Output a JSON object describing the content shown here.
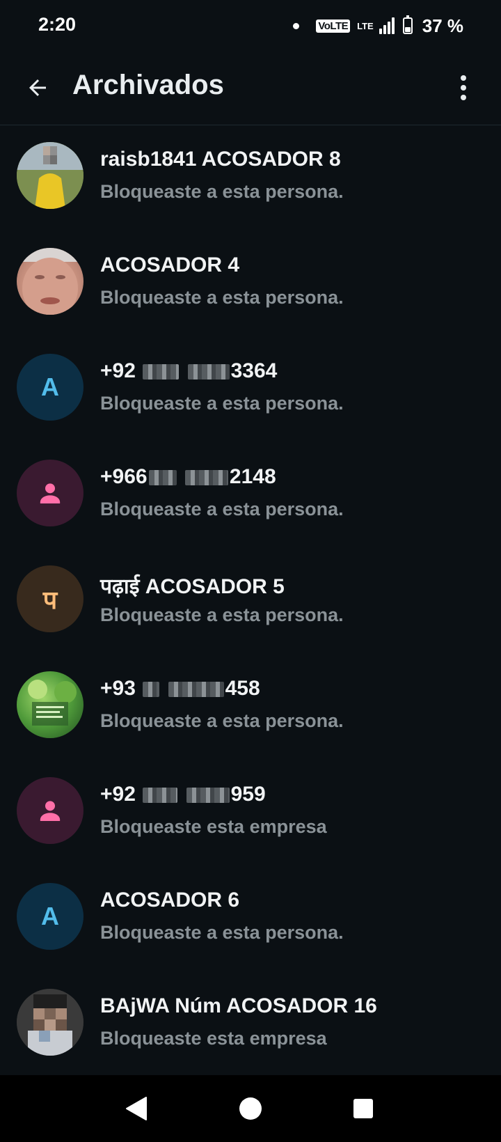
{
  "status_bar": {
    "time": "2:20",
    "volte": "VoLTE",
    "network": "LTE",
    "battery_text": "37 %",
    "battery_level": 0.37
  },
  "app_bar": {
    "title": "Archivados",
    "back_icon": "arrow-back-icon",
    "menu_icon": "more-vert-icon"
  },
  "colors": {
    "background": "#0b1014",
    "title": "#e9edef",
    "secondary_text": "#8a9297",
    "avatar_blue_bg": "#0c2f45",
    "avatar_blue_fg": "#53bdeb",
    "avatar_pink_bg": "#3a1a30",
    "avatar_pink_fg": "#ff6fa8",
    "avatar_brown_bg": "#382a1d",
    "avatar_brown_fg": "#ffbd7a"
  },
  "chats": [
    {
      "name": "raisb1841 ACOSADOR 8",
      "status": "Bloqueaste a esta persona.",
      "avatar": "photo"
    },
    {
      "name": "ACOSADOR 4",
      "status": "Bloqueaste a esta persona.",
      "avatar": "photo"
    },
    {
      "name_prefix": "+92",
      "name_suffix": "3364",
      "status": "Bloqueaste a esta persona.",
      "avatar": "letter",
      "letter": "A"
    },
    {
      "name_prefix": "+966",
      "name_suffix": "2148",
      "status": "Bloqueaste a esta persona.",
      "avatar": "person-icon"
    },
    {
      "name": "पढ़ाई ACOSADOR 5",
      "status": "Bloqueaste a esta persona.",
      "avatar": "letter",
      "letter": "प"
    },
    {
      "name_prefix": "+93",
      "name_suffix": "458",
      "status": "Bloqueaste a esta persona.",
      "avatar": "photo"
    },
    {
      "name_prefix": "+92",
      "name_suffix": "959",
      "status": "Bloqueaste esta empresa",
      "avatar": "person-icon"
    },
    {
      "name": "ACOSADOR 6",
      "status": "Bloqueaste a esta persona.",
      "avatar": "letter",
      "letter": "A"
    },
    {
      "name": "BAjWA Núm ACOSADOR 16",
      "status": "Bloqueaste esta empresa",
      "avatar": "photo"
    }
  ],
  "nav_bar": {
    "back_icon": "triangle-back-icon",
    "home_icon": "circle-home-icon",
    "recents_icon": "square-recents-icon"
  }
}
